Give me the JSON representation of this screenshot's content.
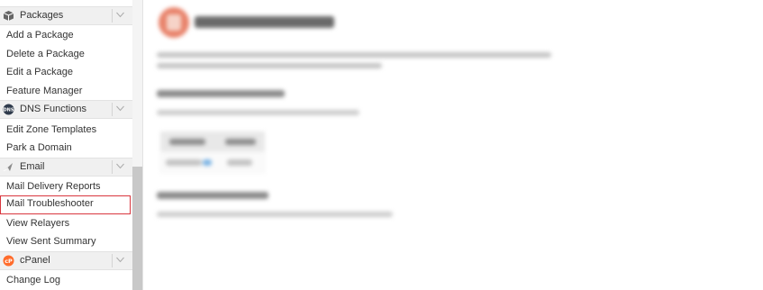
{
  "sidebar": {
    "groups": [
      {
        "header": "Packages",
        "icon": "package-icon",
        "items": [
          "Add a Package",
          "Delete a Package",
          "Edit a Package",
          "Feature Manager"
        ]
      },
      {
        "header": "DNS Functions",
        "icon": "dns-icon",
        "items": [
          "Edit Zone Templates",
          "Park a Domain"
        ]
      },
      {
        "header": "Email",
        "icon": "email-icon",
        "items": [
          "Mail Delivery Reports",
          "Mail Troubleshooter",
          "View Relayers",
          "View Sent Summary"
        ]
      },
      {
        "header": "cPanel",
        "icon": "cpanel-icon",
        "items": [
          "Change Log"
        ]
      }
    ],
    "selected_item": "Mail Troubleshooter"
  },
  "colors": {
    "selection_border": "#d9363e",
    "cpanel_orange": "#ff6c2c"
  }
}
